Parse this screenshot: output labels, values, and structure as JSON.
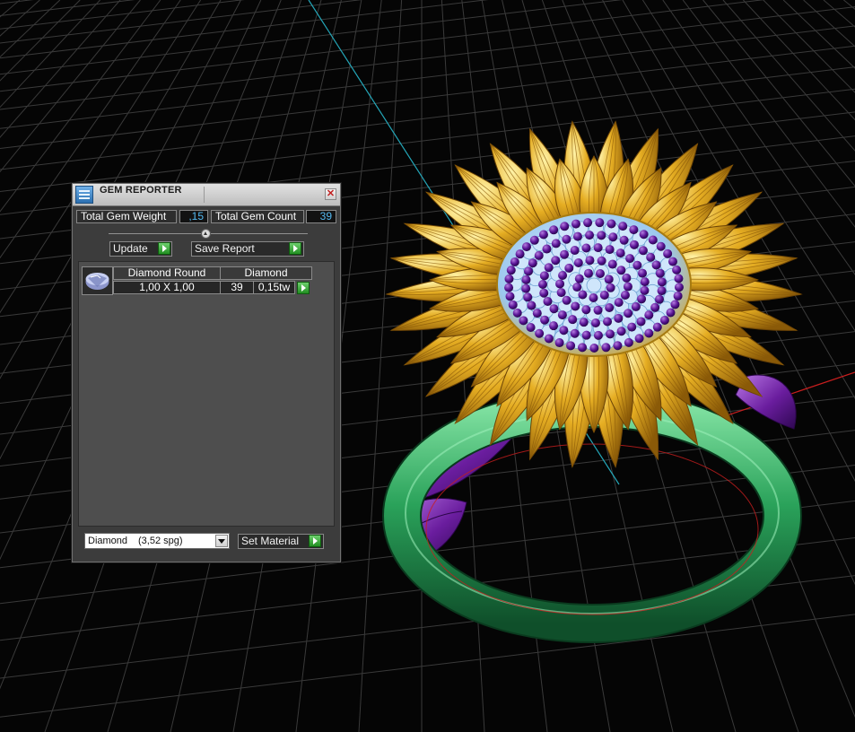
{
  "panel": {
    "title": "GEM REPORTER",
    "close_glyph": "✕",
    "total_gem_weight_label": "Total Gem Weight",
    "total_gem_weight_value": ",15",
    "total_gem_count_label": "Total Gem Count",
    "total_gem_count_value": "39",
    "update_label": "Update",
    "save_report_label": "Save Report",
    "gem_list": {
      "items": [
        {
          "shape": "Diamond Round",
          "size": "1,00 X 1,00",
          "material": "Diamond",
          "count": "39",
          "weight": "0,15tw",
          "icon": "round-gem-icon"
        }
      ]
    },
    "material_select": {
      "value": "Diamond",
      "spg": "(3,52 spg)"
    },
    "set_material_label": "Set Material"
  },
  "viewport": {
    "model": "sunflower-ring",
    "colors": {
      "background": "#050505",
      "grid": "#3a3a3a",
      "y_axis": "#24a6b8",
      "x_axis": "#c81e1e",
      "petals": "#e5ad22",
      "center": "#9cc8ee",
      "prongs": "#5a1496",
      "leaves": "#6a1d9e",
      "band": "#2aa25a"
    }
  }
}
